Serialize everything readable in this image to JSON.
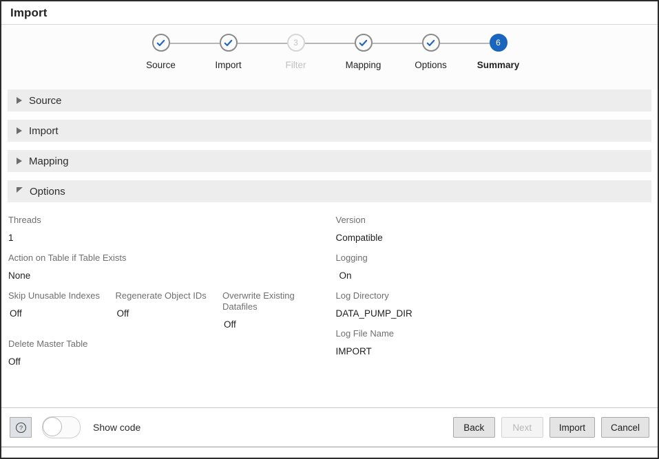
{
  "window": {
    "title": "Import"
  },
  "stepper": {
    "steps": [
      {
        "number": "1",
        "label": "Source",
        "state": "done"
      },
      {
        "number": "2",
        "label": "Import",
        "state": "done"
      },
      {
        "number": "3",
        "label": "Filter",
        "state": "disabled"
      },
      {
        "number": "4",
        "label": "Mapping",
        "state": "done"
      },
      {
        "number": "5",
        "label": "Options",
        "state": "done"
      },
      {
        "number": "6",
        "label": "Summary",
        "state": "current"
      }
    ],
    "colors": {
      "current_fill": "#1a66bf",
      "check_blue": "#2166c0",
      "done_ring": "#8a8a8a",
      "disabled_ring": "#d5d5d5",
      "connector": "#b6b6b6"
    }
  },
  "sections": [
    {
      "title": "Source",
      "expanded": false,
      "icon": "triangle-right-icon"
    },
    {
      "title": "Import",
      "expanded": false,
      "icon": "triangle-right-icon"
    },
    {
      "title": "Mapping",
      "expanded": false,
      "icon": "triangle-right-icon"
    },
    {
      "title": "Options",
      "expanded": true,
      "icon": "triangle-down-icon"
    }
  ],
  "options": {
    "left": {
      "threads": {
        "label": "Threads",
        "value": "1"
      },
      "action_on_table": {
        "label": "Action on Table if Table Exists",
        "value": "None"
      },
      "triple": [
        {
          "label": "Skip Unusable Indexes",
          "value": "Off"
        },
        {
          "label": "Regenerate Object IDs",
          "value": "Off"
        },
        {
          "label": "Overwrite Existing Datafiles",
          "value": "Off"
        }
      ],
      "delete_master_table": {
        "label": "Delete Master Table",
        "value": "Off"
      }
    },
    "right": {
      "version": {
        "label": "Version",
        "value": "Compatible"
      },
      "logging": {
        "label": "Logging",
        "value": "On"
      },
      "log_directory": {
        "label": "Log Directory",
        "value": "DATA_PUMP_DIR"
      },
      "log_file_name": {
        "label": "Log File Name",
        "value": "IMPORT"
      }
    }
  },
  "footer": {
    "help_icon": "question-mark-circle-icon",
    "show_code_label": "Show code",
    "show_code_state": "off",
    "buttons": [
      {
        "label": "Back",
        "disabled": false
      },
      {
        "label": "Next",
        "disabled": true
      },
      {
        "label": "Import",
        "disabled": false
      },
      {
        "label": "Cancel",
        "disabled": false
      }
    ]
  }
}
